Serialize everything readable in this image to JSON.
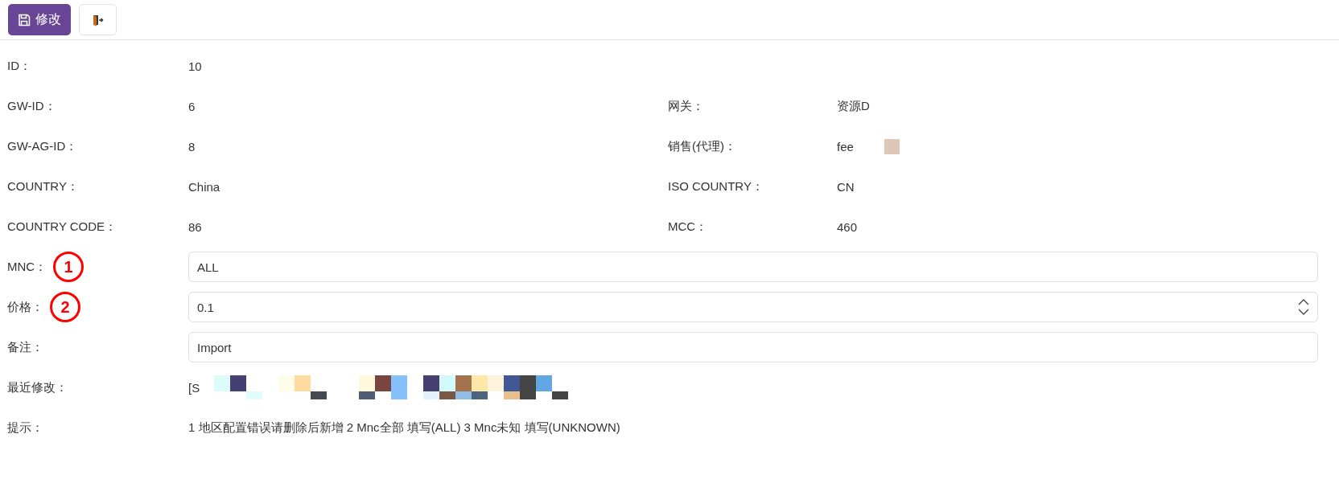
{
  "toolbar": {
    "save_label": "修改"
  },
  "rows": [
    {
      "kind": "pair",
      "label": "ID：",
      "value": "10"
    },
    {
      "kind": "pair",
      "label": "GW-ID：",
      "value": "6",
      "right_label": "网关：",
      "right_value": "资源D"
    },
    {
      "kind": "pair",
      "label": "GW-AG-ID：",
      "value": "8",
      "right_label": "销售(代理)：",
      "right_value": "fee",
      "right_redacted": true
    },
    {
      "kind": "pair",
      "label": "COUNTRY：",
      "value": "China",
      "right_label": "ISO COUNTRY：",
      "right_value": "CN"
    },
    {
      "kind": "pair",
      "label": "COUNTRY CODE：",
      "value": "86",
      "right_label": "MCC：",
      "right_value": "460"
    },
    {
      "kind": "input",
      "label": "MNC：",
      "value": "ALL",
      "annotation": "1"
    },
    {
      "kind": "number",
      "label": "价格：",
      "value": "0.1",
      "annotation": "2"
    },
    {
      "kind": "input",
      "label": "备注：",
      "value": "Import"
    },
    {
      "kind": "redacted",
      "label": "最近修改：",
      "value": "[S"
    },
    {
      "kind": "pair",
      "label": "提示：",
      "value": "1 地区配置错误请删除后新增 2 Mnc全部 填写(ALL) 3 Mnc未知 填写(UNKNOWN)"
    }
  ]
}
